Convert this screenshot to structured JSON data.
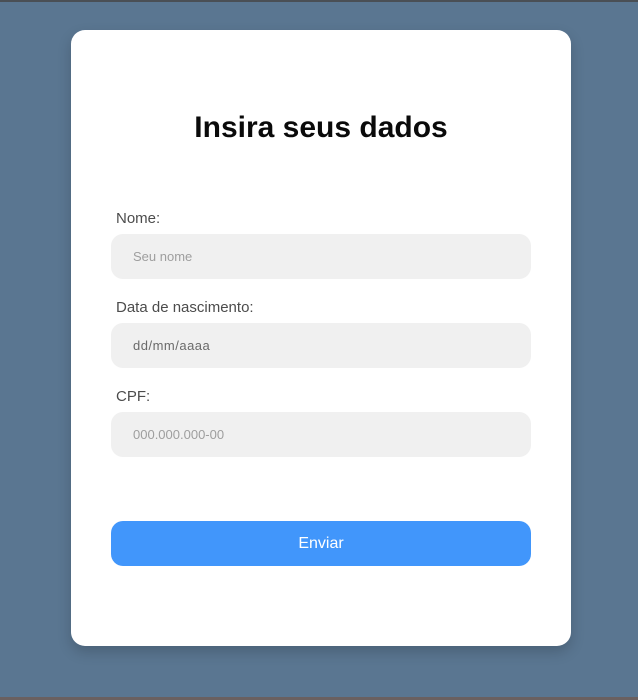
{
  "form": {
    "title": "Insira seus dados",
    "fields": [
      {
        "label": "Nome:",
        "placeholder": "Seu nome",
        "value": ""
      },
      {
        "label": "Data de nascimento:",
        "placeholder": "",
        "value": "dd/mm/aaaa"
      },
      {
        "label": "CPF:",
        "placeholder": "000.000.000-00",
        "value": ""
      }
    ],
    "submit_label": "Enviar"
  },
  "colors": {
    "background": "#5a7691",
    "card": "#ffffff",
    "input_background": "#f0f0f0",
    "button": "#4196fb",
    "button_text": "#ffffff"
  }
}
